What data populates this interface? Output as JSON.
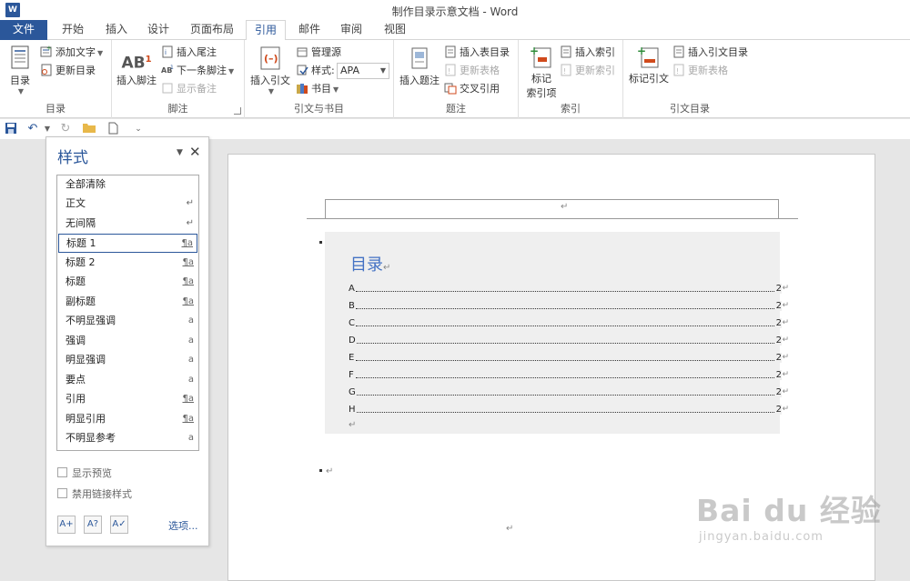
{
  "app": {
    "title": "制作目录示意文档 - Word",
    "logo": "W"
  },
  "tabs": [
    {
      "label": "文件"
    },
    {
      "label": "开始"
    },
    {
      "label": "插入"
    },
    {
      "label": "设计"
    },
    {
      "label": "页面布局"
    },
    {
      "label": "引用"
    },
    {
      "label": "邮件"
    },
    {
      "label": "审阅"
    },
    {
      "label": "视图"
    }
  ],
  "ribbon": {
    "toc_group": {
      "label": "目录",
      "toc_button": "目录",
      "add_text": "添加文字",
      "update_toc": "更新目录"
    },
    "footnote_group": {
      "label": "脚注",
      "insert_footnote": "插入脚注",
      "insert_endnote": "插入尾注",
      "next_footnote": "下一条脚注",
      "show_notes": "显示备注",
      "ab_glyph": "AB",
      "ab_sup": "1"
    },
    "citation_group": {
      "label": "引文与书目",
      "insert_citation": "插入引文",
      "manage_sources": "管理源",
      "style_label": "样式:",
      "style_value": "APA",
      "bibliography": "书目"
    },
    "caption_group": {
      "label": "题注",
      "insert_caption": "插入题注",
      "insert_table_of_figures": "插入表目录",
      "update_table": "更新表格",
      "cross_reference": "交叉引用"
    },
    "index_group": {
      "label": "索引",
      "mark_entry": "标记\n索引项",
      "mark_entry_line1": "标记",
      "mark_entry_line2": "索引项",
      "insert_index": "插入索引",
      "update_index": "更新索引"
    },
    "toa_group": {
      "label": "引文目录",
      "mark_citation": "标记引文",
      "insert_toa": "插入引文目录",
      "update_table": "更新表格"
    }
  },
  "styles_pane": {
    "title": "样式",
    "items": [
      {
        "name": "全部清除",
        "marker": ""
      },
      {
        "name": "正文",
        "marker": "↵"
      },
      {
        "name": "无间隔",
        "marker": "↵"
      },
      {
        "name": "标题 1",
        "marker": "¶a"
      },
      {
        "name": "标题 2",
        "marker": "¶a"
      },
      {
        "name": "标题",
        "marker": "¶a"
      },
      {
        "name": "副标题",
        "marker": "¶a"
      },
      {
        "name": "不明显强调",
        "marker": "a"
      },
      {
        "name": "强调",
        "marker": "a"
      },
      {
        "name": "明显强调",
        "marker": "a"
      },
      {
        "name": "要点",
        "marker": "a"
      },
      {
        "name": "引用",
        "marker": "¶a"
      },
      {
        "name": "明显引用",
        "marker": "¶a"
      },
      {
        "name": "不明显参考",
        "marker": "a"
      }
    ],
    "show_preview": "显示预览",
    "disable_linked": "禁用链接样式",
    "options": "选项..."
  },
  "document": {
    "toc_title": "目录",
    "para_mark": "↵",
    "entries": [
      {
        "label": "A",
        "page": "2"
      },
      {
        "label": "B",
        "page": "2"
      },
      {
        "label": "C",
        "page": "2"
      },
      {
        "label": "D",
        "page": "2"
      },
      {
        "label": "E",
        "page": "2"
      },
      {
        "label": "F",
        "page": "2"
      },
      {
        "label": "G",
        "page": "2"
      },
      {
        "label": "H",
        "page": "2"
      }
    ]
  },
  "watermark": {
    "main": "Bai du 经验",
    "sub": "jingyan.baidu.com"
  },
  "colors": {
    "accent": "#2b579a",
    "toc_title": "#4472c4"
  }
}
